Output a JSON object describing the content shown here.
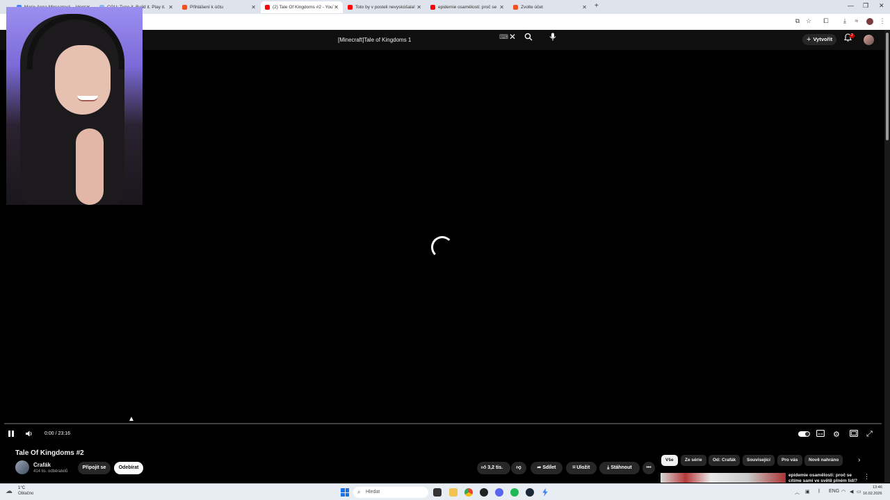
{
  "browser": {
    "tabs": [
      {
        "title": "Marie Anna Mircaatová – Identi"
      },
      {
        "title": "CGU: Tune it. Build it. Play it."
      },
      {
        "title": "Přihlášení k účtu"
      },
      {
        "title": "(2) Tale Of Kingdoms #2 - YouT"
      },
      {
        "title": "Toto by v posteli nevyskúšala!"
      },
      {
        "title": "epidemie osamělosti: proč se"
      },
      {
        "title": "Zvolte účet"
      }
    ],
    "new_tab_icon": "plus-icon",
    "active_tab": 3
  },
  "youtube": {
    "search_value": "[Minecraft]Tale of Kingdoms 1",
    "create_label": "Vytvořit",
    "notification_count": "2",
    "player": {
      "time": "0:00 / 23:16",
      "state": "buffering",
      "played_fraction": 0.0
    },
    "video": {
      "title": "Tale Of Kingdoms #2",
      "channel": "Crafák",
      "subscribers": "414 tis. odběratelů",
      "join_label": "Připojit se",
      "subscribe_label": "Odebírat",
      "likes": "3,2 tis.",
      "share_label": "Sdílet",
      "save_label": "Uložit",
      "download_label": "Stáhnout"
    },
    "chips": [
      "Vše",
      "Ze série",
      "Od: Crafák",
      "Související",
      "Pro vás",
      "Nově nahráno"
    ],
    "recommendation": {
      "title": "epidemie osamělosti: proč se cítíme sami ve světě plném lidí?"
    }
  },
  "taskbar": {
    "weather_temp": "1°C",
    "weather_desc": "Oblačno",
    "search_placeholder": "Hledat",
    "lang": "ENG",
    "time": "13:46",
    "date": "16.02.2026"
  },
  "colors": {
    "yt_bg": "#0f0f0f",
    "chip_bg": "#272727",
    "badge_red": "#cc0000",
    "tab_strip": "#dfe3eb"
  }
}
